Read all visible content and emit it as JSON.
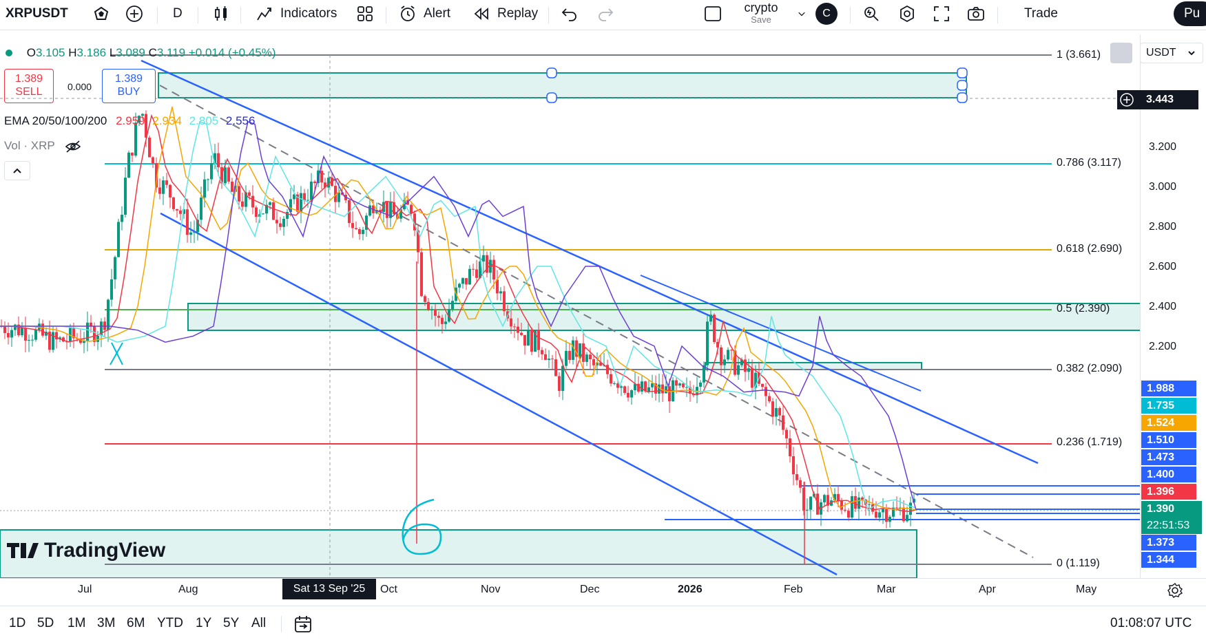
{
  "topbar": {
    "symbol": "XRPUSDT",
    "interval": "D",
    "indicators_label": "Indicators",
    "alert_label": "Alert",
    "replay_label": "Replay",
    "layout_name": "crypto",
    "layout_save": "Save",
    "avatar_letter": "C",
    "trade_label": "Trade",
    "publish_partial": "Pu",
    "icons": [
      "favorite-icon",
      "add-symbol-icon",
      "candles-icon",
      "indicators-icon",
      "templates-icon",
      "alert-icon",
      "replay-icon",
      "undo-icon",
      "redo-icon",
      "layout-icon",
      "chevron-down-icon",
      "quick-search-icon",
      "settings-icon",
      "fullscreen-icon",
      "snapshot-icon"
    ]
  },
  "legend": {
    "open_label": "O",
    "open": "3.105",
    "high_label": "H",
    "high": "3.186",
    "low_label": "L",
    "low": "3.089",
    "close_label": "C",
    "close": "3.119",
    "change": "+0.014 (+0.45%)",
    "sell_price": "1.389",
    "sell_label": "SELL",
    "spread": "0.000",
    "buy_price": "1.389",
    "buy_label": "BUY",
    "ema_label": "EMA 20/50/100/200",
    "ema20": "2.959",
    "ema50": "2.934",
    "ema100": "2.805",
    "ema200": "2.556",
    "vol_label": "Vol · XRP"
  },
  "colors": {
    "up": "#089981",
    "down": "#f23645",
    "ema20": "#f23645",
    "ema50": "#f7a600",
    "ema100": "#5ee6e6",
    "ema200": "#6b3fd6",
    "channel": "#2962ff",
    "zone": "#089981"
  },
  "fib": [
    {
      "label": "1 (3.661)",
      "color": "#787b86"
    },
    {
      "label": "0.786 (3.117)",
      "color": "#00bcd4"
    },
    {
      "label": "0.618 (2.690)",
      "color": "#e0a800"
    },
    {
      "label": "0.5 (2.390)",
      "color": "#4caf50"
    },
    {
      "label": "0.382 (2.090)",
      "color": "#787b86"
    },
    {
      "label": "0.236 (1.719)",
      "color": "#f23645"
    },
    {
      "label": "0 (1.119)",
      "color": "#787b86"
    }
  ],
  "price_axis": {
    "currency": "USDT",
    "ticks": [
      "3.200",
      "3.000",
      "2.800",
      "2.600",
      "2.400",
      "2.200"
    ],
    "crosshair_price": "3.443",
    "labels": [
      {
        "value": "1.988",
        "color": "#2962ff"
      },
      {
        "value": "1.735",
        "color": "#00bcd4"
      },
      {
        "value": "1.524",
        "color": "#f7a600"
      },
      {
        "value": "1.510",
        "color": "#2962ff"
      },
      {
        "value": "1.473",
        "color": "#2962ff"
      },
      {
        "value": "1.400",
        "color": "#2962ff"
      },
      {
        "value": "1.396",
        "color": "#f23645"
      },
      {
        "value": "1.373",
        "color": "#2962ff"
      },
      {
        "value": "1.344",
        "color": "#2962ff"
      }
    ],
    "last_price": "1.390",
    "countdown": "22:51:53"
  },
  "time_axis": {
    "months": [
      "Jul",
      "Aug",
      "Oct",
      "Nov",
      "Dec",
      "2026",
      "Feb",
      "Mar",
      "Apr",
      "May"
    ],
    "crosshair_date": "Sat 13 Sep '25"
  },
  "watermark": "TradingView",
  "annotation": "6",
  "bottombar": {
    "ranges": [
      "1D",
      "5D",
      "1M",
      "3M",
      "6M",
      "YTD",
      "1Y",
      "5Y",
      "All"
    ],
    "clock": "01:08:07 UTC"
  }
}
